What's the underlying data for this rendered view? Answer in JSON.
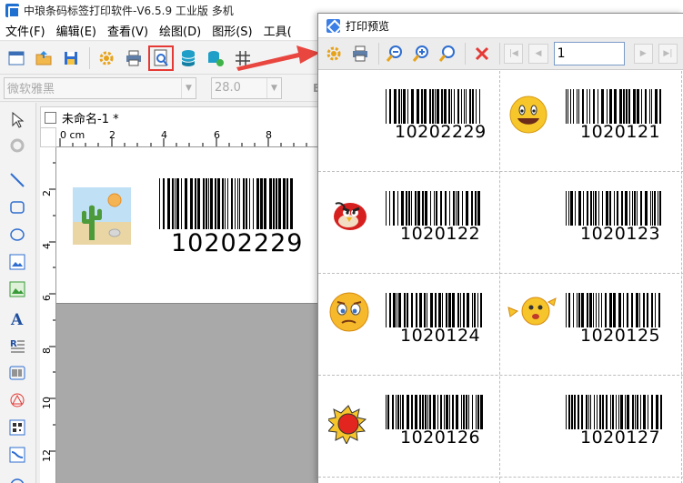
{
  "main_window": {
    "title": "中琅条码标签打印软件-V6.5.9 工业版 多机",
    "menu": [
      "文件(F)",
      "编辑(E)",
      "查看(V)",
      "绘图(D)",
      "图形(S)",
      "工具("
    ],
    "font_name": "微软雅黑",
    "font_size": "28.0",
    "bold_label": "B",
    "document_tab": "未命名-1 *",
    "ruler_top": [
      "0 cm",
      "2",
      "4",
      "6",
      "8"
    ],
    "ruler_left": [
      "2",
      "4",
      "6",
      "8",
      "10",
      "12"
    ],
    "canvas_label": {
      "image": "cactus-desert-icon",
      "barcode_text": "10202229"
    },
    "highlighted_tool": "print-preview-button"
  },
  "preview": {
    "title": "打印预览",
    "page_value": "1",
    "labels": [
      {
        "code": "10202229",
        "image": ""
      },
      {
        "code": "1020121",
        "image": "smiley-emoji"
      },
      {
        "code": "1020122",
        "image": "angry-bird"
      },
      {
        "code": "1020123",
        "image": ""
      },
      {
        "code": "1020124",
        "image": "worried-emoji"
      },
      {
        "code": "1020125",
        "image": "waving-emoji"
      },
      {
        "code": "1020126",
        "image": "sun-icon"
      },
      {
        "code": "1020127",
        "image": ""
      }
    ]
  },
  "colors": {
    "highlight_red": "#e53935",
    "arrow_red": "#e8463f",
    "accent_blue": "#1f6fd1"
  }
}
